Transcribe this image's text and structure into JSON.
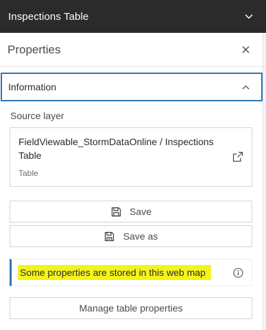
{
  "topbar": {
    "title": "Inspections Table",
    "toggle_icon": "chevron-down-icon"
  },
  "properties": {
    "title": "Properties",
    "close_icon": "close-icon"
  },
  "information": {
    "title": "Information",
    "toggle_icon": "chevron-up-icon"
  },
  "source_layer": {
    "label": "Source layer",
    "name": "FieldViewable_StormDataOnline / Inspections Table",
    "type": "Table",
    "open_icon": "external-link-icon"
  },
  "actions": {
    "save_label": "Save",
    "save_icon": "save-icon",
    "save_as_label": "Save as",
    "save_as_icon": "save-as-icon"
  },
  "notice": {
    "text": "Some properties are stored in this web map",
    "info_icon": "info-icon",
    "highlight_color": "#f4f41c",
    "accent_color": "#2f74b5"
  },
  "manage": {
    "label": "Manage table properties"
  }
}
